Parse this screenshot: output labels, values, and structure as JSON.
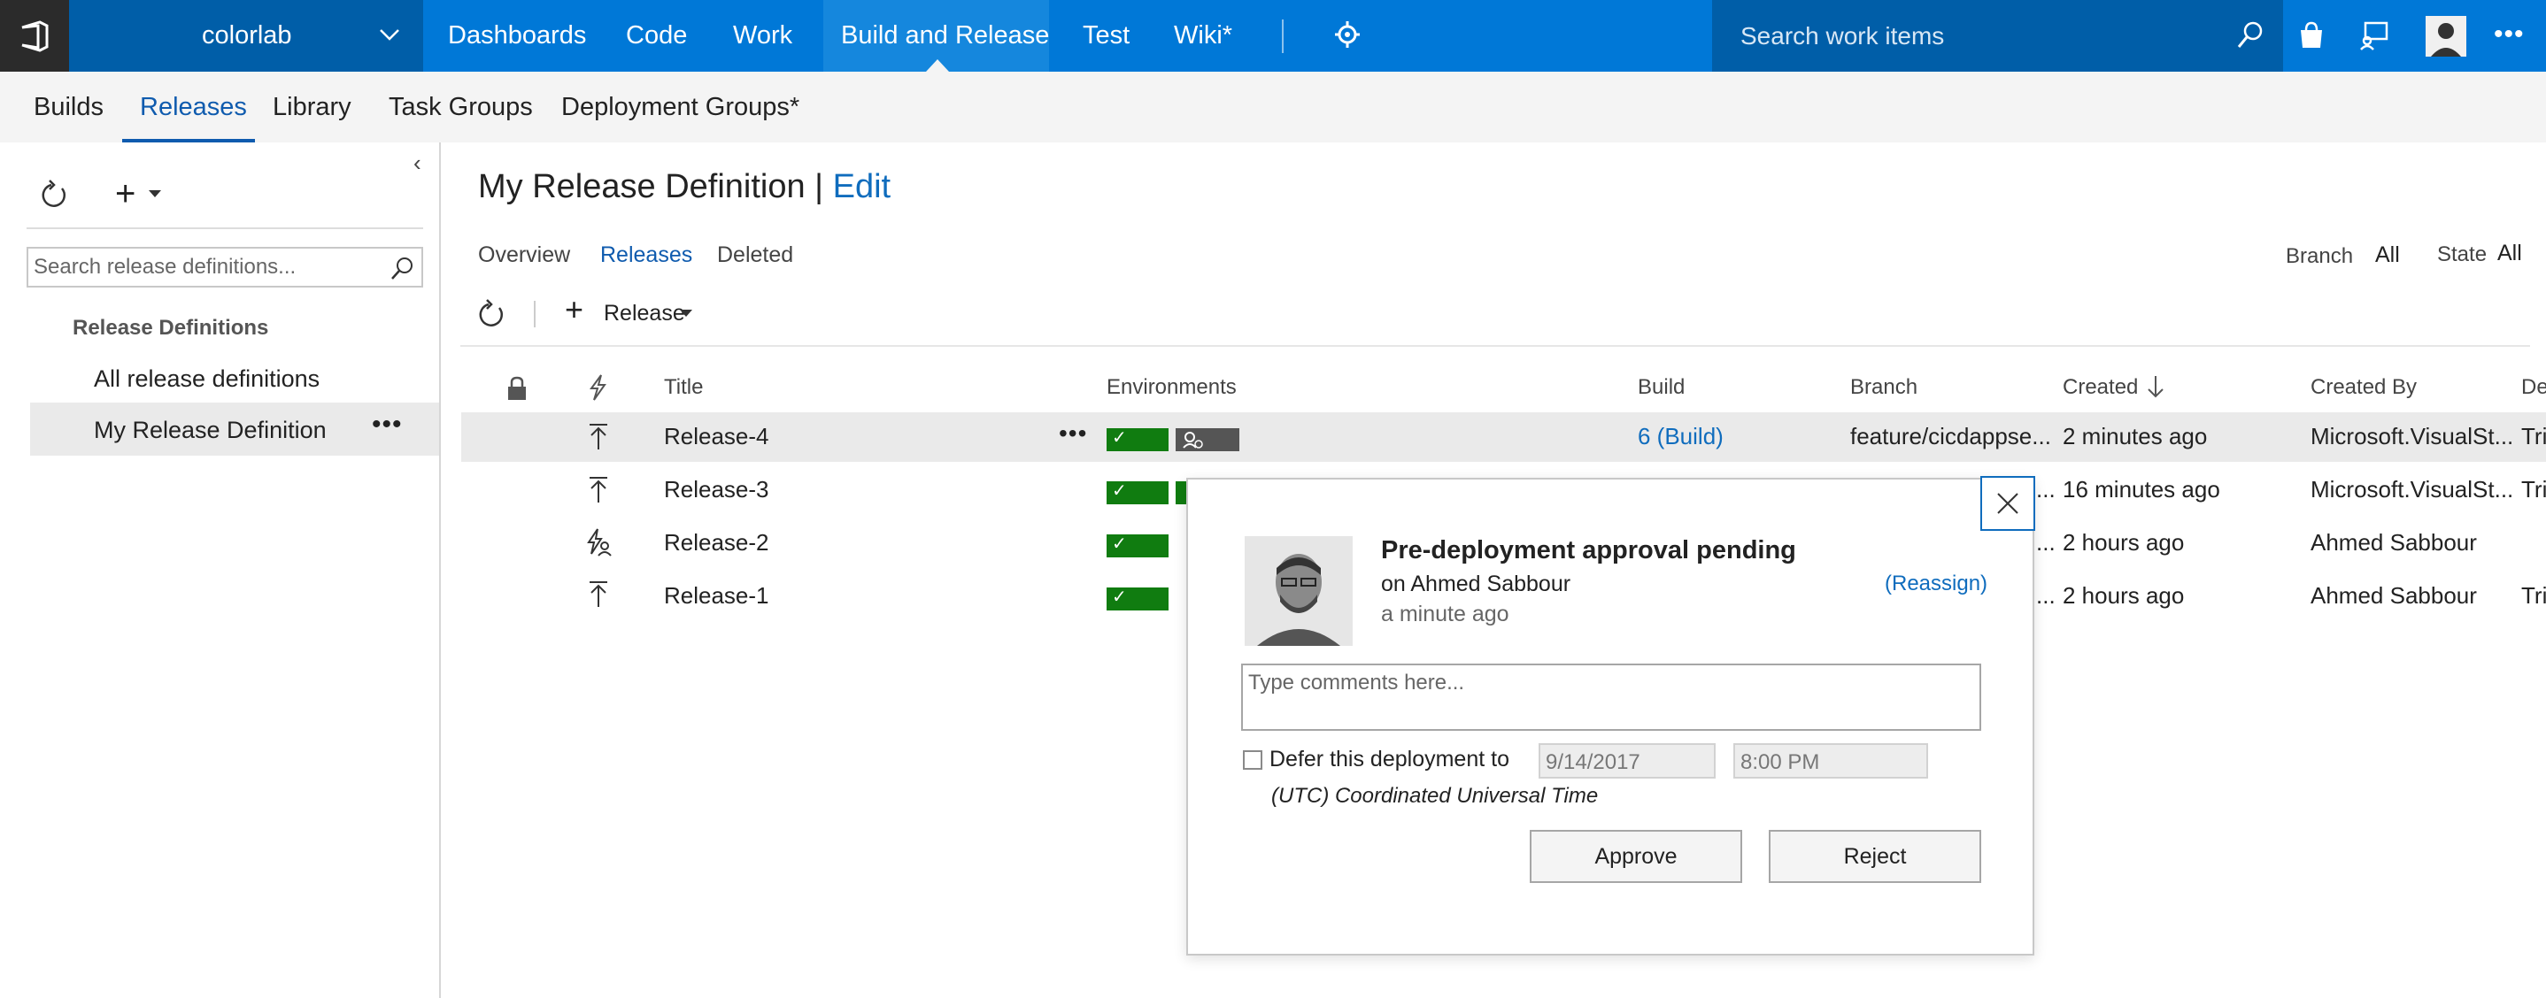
{
  "topbar": {
    "project": "colorlab",
    "nav": [
      "Dashboards",
      "Code",
      "Work",
      "Build and Release",
      "Test",
      "Wiki*"
    ],
    "search_placeholder": "Search work items",
    "accent": "#0078d7"
  },
  "subnav": {
    "tabs": [
      "Builds",
      "Releases",
      "Library",
      "Task Groups",
      "Deployment Groups*"
    ],
    "active": "Releases"
  },
  "left": {
    "search_placeholder": "Search release definitions...",
    "header": "Release Definitions",
    "all": "All release definitions",
    "selected": "My Release Definition",
    "more": "•••"
  },
  "main": {
    "title": "My Release Definition",
    "separator": " | ",
    "edit": "Edit",
    "tabs": [
      "Overview",
      "Releases",
      "Deleted"
    ],
    "filters": {
      "branch_label": "Branch",
      "branch_value": "All",
      "state_label": "State",
      "state_value": "All"
    },
    "toolbar": {
      "release_label": "Release"
    },
    "columns": [
      "Title",
      "Environments",
      "Build",
      "Branch",
      "Created",
      "Created By",
      "De"
    ],
    "rows": [
      {
        "title": "Release-4",
        "more": "•••",
        "build": "6 (Build)",
        "branch": "feature/cicdappse...",
        "created": "2 minutes ago",
        "created_by": "Microsoft.VisualSt...",
        "de": "Tri"
      },
      {
        "title": "Release-3",
        "branch": "...",
        "created": "16 minutes ago",
        "created_by": "Microsoft.VisualSt...",
        "de": "Tri"
      },
      {
        "title": "Release-2",
        "branch": "...",
        "created": "2 hours ago",
        "created_by": "Ahmed Sabbour",
        "de": ""
      },
      {
        "title": "Release-1",
        "branch": "...",
        "created": "2 hours ago",
        "created_by": "Ahmed Sabbour",
        "de": "Tri"
      }
    ]
  },
  "dialog": {
    "title": "Pre-deployment approval pending",
    "approver": "on Ahmed Sabbour",
    "time": "a minute ago",
    "reassign": "(Reassign)",
    "comments_placeholder": "Type comments here...",
    "defer_label": "Defer this deployment to",
    "date": "9/14/2017",
    "time_value": "8:00 PM",
    "timezone": "(UTC) Coordinated Universal Time",
    "approve": "Approve",
    "reject": "Reject"
  },
  "colors": {
    "success": "#107c10",
    "link": "#0f6cbd"
  }
}
